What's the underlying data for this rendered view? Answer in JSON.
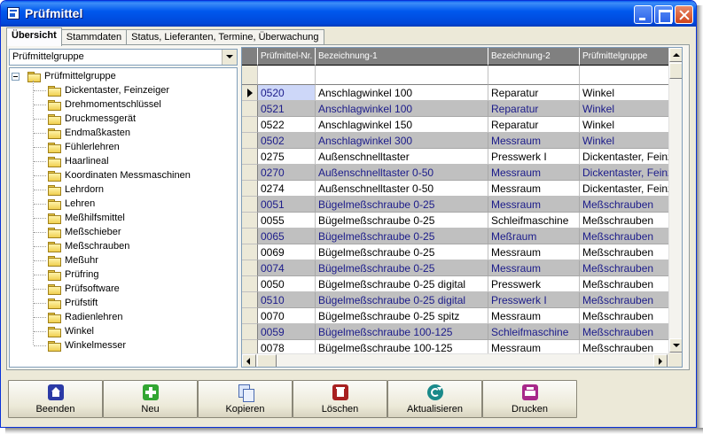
{
  "window": {
    "title": "Prüfmittel"
  },
  "tabs": [
    {
      "label": "Übersicht"
    },
    {
      "label": "Stammdaten"
    },
    {
      "label": "Status, Lieferanten, Termine, Überwachung"
    }
  ],
  "filter": {
    "selected": "Prüfmittelgruppe"
  },
  "tree": {
    "root": "Prüfmittelgruppe",
    "items": [
      "Dickentaster, Feinzeiger",
      "Drehmomentschlüssel",
      "Druckmessgerät",
      "Endmaßkasten",
      "Fühlerlehren",
      "Haarlineal",
      "Koordinaten Messmaschinen",
      "Lehrdorn",
      "Lehren",
      "Meßhilfsmittel",
      "Meßschieber",
      "Meßschrauben",
      "Meßuhr",
      "Prüfring",
      "Prüfsoftware",
      "Prüfstift",
      "Radienlehren",
      "Winkel",
      "Winkelmesser"
    ]
  },
  "grid": {
    "columns": [
      "Prüfmittel-Nr.",
      "Bezeichnung-1",
      "Bezeichnung-2",
      "Prüfmittelgruppe"
    ],
    "rows": [
      [
        "0520",
        "Anschlagwinkel 100",
        "Reparatur",
        "Winkel"
      ],
      [
        "0521",
        "Anschlagwinkel 100",
        "Reparatur",
        "Winkel"
      ],
      [
        "0522",
        "Anschlagwinkel 150",
        "Reparatur",
        "Winkel"
      ],
      [
        "0502",
        "Anschlagwinkel 300",
        "Messraum",
        "Winkel"
      ],
      [
        "0275",
        "Außenschnelltaster",
        "Presswerk I",
        "Dickentaster, Feinzeiger"
      ],
      [
        "0270",
        "Außenschnelltaster 0-50",
        "Messraum",
        "Dickentaster, Feinzeiger"
      ],
      [
        "0274",
        "Außenschnelltaster 0-50",
        "Messraum",
        "Dickentaster, Feinzeiger"
      ],
      [
        "0051",
        "Bügelmeßschraube 0-25",
        "Messraum",
        "Meßschrauben"
      ],
      [
        "0055",
        "Bügelmeßschraube 0-25",
        "Schleifmaschine",
        "Meßschrauben"
      ],
      [
        "0065",
        "Bügelmeßschraube 0-25",
        "Meßraum",
        "Meßschrauben"
      ],
      [
        "0069",
        "Bügelmeßschraube 0-25",
        "Messraum",
        "Meßschrauben"
      ],
      [
        "0074",
        "Bügelmeßschraube 0-25",
        "Messraum",
        "Meßschrauben"
      ],
      [
        "0050",
        "Bügelmeßschraube 0-25 digital",
        "Presswerk",
        "Meßschrauben"
      ],
      [
        "0510",
        "Bügelmeßschraube 0-25 digital",
        "Presswerk I",
        "Meßschrauben"
      ],
      [
        "0070",
        "Bügelmeßschraube 0-25 spitz",
        "Messraum",
        "Meßschrauben"
      ],
      [
        "0059",
        "Bügelmeßschraube 100-125",
        "Schleifmaschine",
        "Meßschrauben"
      ],
      [
        "0078",
        "Bügelmeßschraube 100-125",
        "Messraum",
        "Meßschrauben"
      ]
    ]
  },
  "toolbar": [
    {
      "name": "beenden-button",
      "icon": "home-icon",
      "label": "Beenden",
      "cls": "i-home"
    },
    {
      "name": "neu-button",
      "icon": "plus-icon",
      "label": "Neu",
      "cls": "i-new"
    },
    {
      "name": "kopieren-button",
      "icon": "copy-icon",
      "label": "Kopieren",
      "cls": "i-copy"
    },
    {
      "name": "loeschen-button",
      "icon": "trash-icon",
      "label": "Löschen",
      "cls": "i-del"
    },
    {
      "name": "aktualisieren-button",
      "icon": "refresh-icon",
      "label": "Aktualisieren",
      "cls": "i-refresh"
    },
    {
      "name": "drucken-button",
      "icon": "printer-icon",
      "label": "Drucken",
      "cls": "i-print"
    }
  ]
}
